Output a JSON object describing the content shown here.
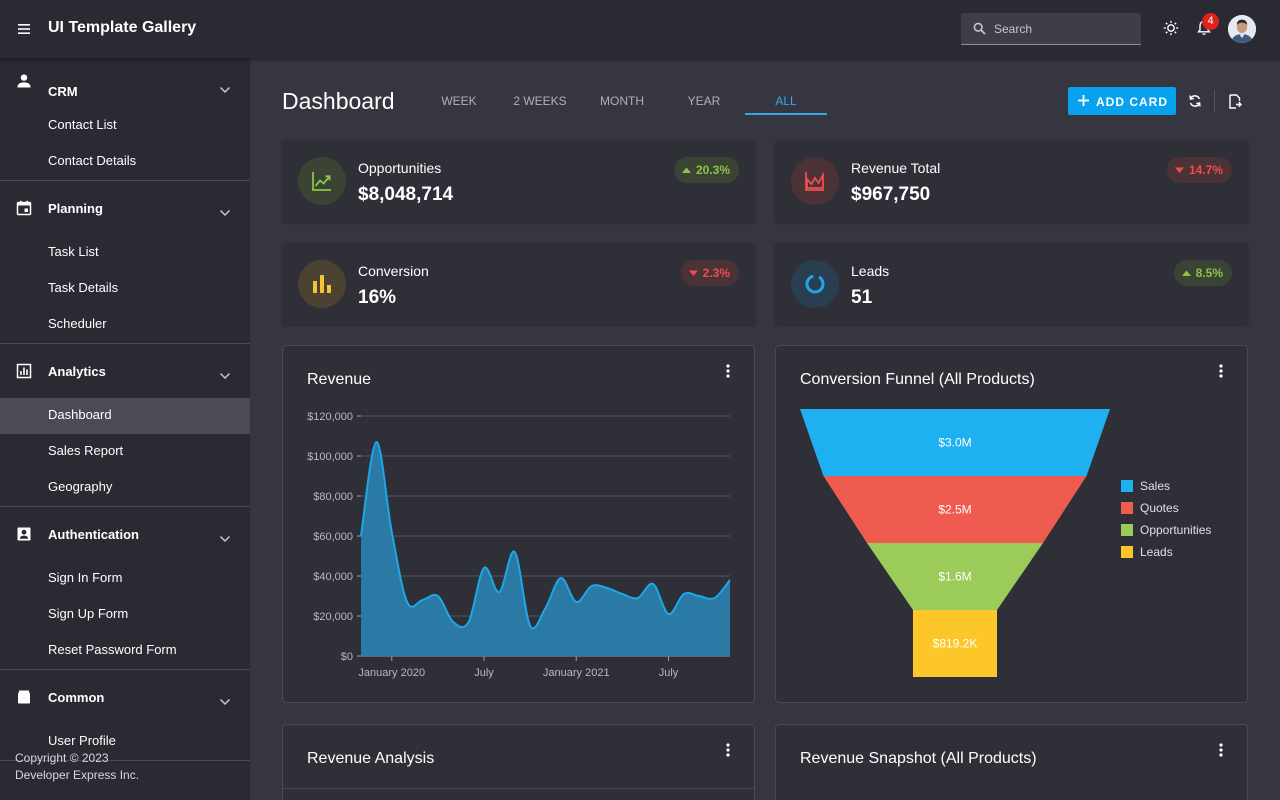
{
  "header": {
    "app_title": "UI Template Gallery",
    "search_placeholder": "Search",
    "notification_count": "4"
  },
  "sidebar": {
    "groups": [
      {
        "label": "CRM",
        "icon": "person-icon",
        "items": [
          "Contact List",
          "Contact Details"
        ]
      },
      {
        "label": "Planning",
        "icon": "calendar-icon",
        "items": [
          "Task List",
          "Task Details",
          "Scheduler"
        ]
      },
      {
        "label": "Analytics",
        "icon": "chart-icon",
        "items": [
          "Dashboard",
          "Sales Report",
          "Geography"
        ]
      },
      {
        "label": "Authentication",
        "icon": "account-box-icon",
        "items": [
          "Sign In Form",
          "Sign Up Form",
          "Reset Password Form"
        ]
      },
      {
        "label": "Common",
        "icon": "folder-icon",
        "items": [
          "User Profile"
        ]
      }
    ],
    "active_item": "Dashboard",
    "copyright_line1": "Copyright © 2023",
    "copyright_line2": "Developer Express Inc."
  },
  "main": {
    "title": "Dashboard",
    "tabs": [
      "WEEK",
      "2 WEEKS",
      "MONTH",
      "YEAR",
      "ALL"
    ],
    "active_tab": "ALL",
    "add_card_label": "ADD CARD",
    "kpis": [
      {
        "label": "Opportunities",
        "value": "$8,048,714",
        "change": "20.3%",
        "trend": "up",
        "icon": "trending-up-icon",
        "color": "#8cc34a"
      },
      {
        "label": "Revenue Total",
        "value": "$967,750",
        "change": "14.7%",
        "trend": "down",
        "icon": "area-chart-icon",
        "color": "#ee4d4d"
      },
      {
        "label": "Conversion",
        "value": "16%",
        "change": "2.3%",
        "trend": "down",
        "icon": "bar-chart-icon",
        "color": "#f6c231"
      },
      {
        "label": "Leads",
        "value": "51",
        "change": "8.5%",
        "trend": "up",
        "icon": "donut-icon",
        "color": "#1ca7e8"
      }
    ],
    "cards": {
      "revenue_title": "Revenue",
      "funnel_title": "Conversion Funnel (All Products)",
      "analysis_title": "Revenue Analysis",
      "snapshot_title": "Revenue Snapshot (All Products)"
    }
  },
  "chart_data": [
    {
      "type": "area",
      "title": "Revenue",
      "ylim": [
        0,
        120000
      ],
      "y_ticks": [
        "$120,000",
        "$100,000",
        "$80,000",
        "$60,000",
        "$40,000",
        "$20,000",
        "$0"
      ],
      "x_ticks": [
        "January 2020",
        "July",
        "January 2021",
        "July"
      ],
      "color": "#1ca7e8",
      "x": [
        "2019-11",
        "2019-12",
        "2020-01",
        "2020-02",
        "2020-03",
        "2020-04",
        "2020-05",
        "2020-06",
        "2020-07",
        "2020-08",
        "2020-09",
        "2020-10",
        "2020-11",
        "2020-12",
        "2021-01",
        "2021-02",
        "2021-03",
        "2021-04",
        "2021-05",
        "2021-06",
        "2021-07",
        "2021-08",
        "2021-09",
        "2021-10",
        "2021-11"
      ],
      "values": [
        60000,
        107000,
        62000,
        27000,
        28000,
        30000,
        17000,
        17000,
        44000,
        32000,
        52000,
        15000,
        24000,
        39000,
        27000,
        35000,
        34000,
        31000,
        29000,
        36000,
        21000,
        31000,
        30000,
        29000,
        38000
      ]
    },
    {
      "type": "funnel",
      "title": "Conversion Funnel (All Products)",
      "categories": [
        "Sales",
        "Quotes",
        "Opportunities",
        "Leads"
      ],
      "labels": [
        "$3.0M",
        "$2.5M",
        "$1.6M",
        "$819.2K"
      ],
      "values": [
        3000000,
        2500000,
        1600000,
        819200
      ],
      "colors": [
        "#1eb0f0",
        "#f05b4f",
        "#9bcb58",
        "#fdc72a"
      ],
      "legend": "right"
    }
  ]
}
